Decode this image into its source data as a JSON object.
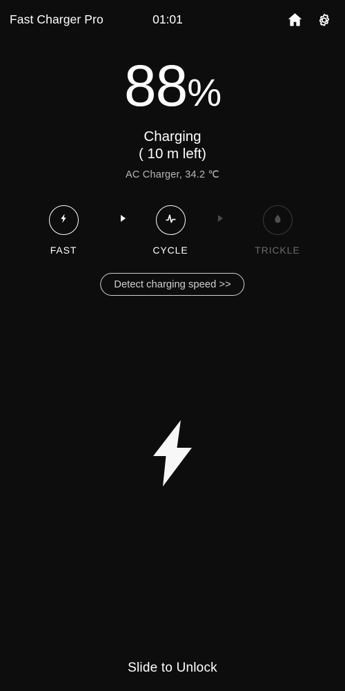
{
  "theme": {
    "background": "#0d0d0d",
    "foreground": "#ffffff",
    "muted": "#b8b8b8",
    "disabled": "#6a6a6a"
  },
  "header": {
    "app_title": "Fast Charger Pro",
    "clock": "01:01",
    "home_icon": "home-icon",
    "settings_icon": "gear-icon"
  },
  "battery": {
    "percent": "88",
    "percent_sign": "%",
    "status": "Charging",
    "time_left": "( 10 m left)",
    "source_and_temp": "AC Charger, 34.2 ℃"
  },
  "modes": {
    "items": [
      {
        "id": "fast",
        "label": "FAST",
        "icon": "lightning-bolt-icon",
        "active": true
      },
      {
        "id": "cycle",
        "label": "CYCLE",
        "icon": "pulse-wave-icon",
        "active": true
      },
      {
        "id": "trickle",
        "label": "TRICKLE",
        "icon": "water-droplet-icon",
        "active": false
      }
    ],
    "separator_icon": "chevron-right-icon"
  },
  "actions": {
    "detect_label": "Detect charging speed >>"
  },
  "hero": {
    "icon": "lightning-bolt-icon"
  },
  "footer": {
    "slide_label": "Slide to Unlock"
  }
}
